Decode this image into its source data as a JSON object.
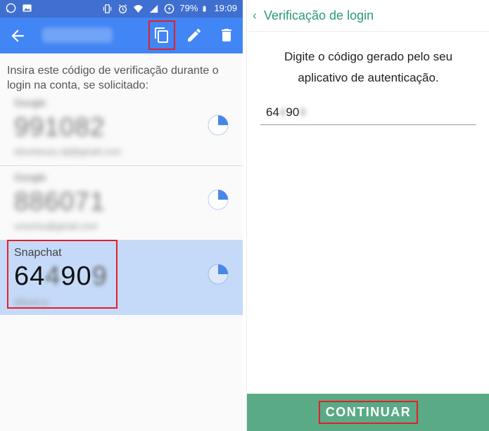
{
  "status_bar": {
    "battery": "79%",
    "time": "19:09"
  },
  "toolbar": {
    "icons": [
      "back-arrow-icon",
      "copy-icon",
      "edit-icon",
      "delete-icon"
    ]
  },
  "authenticator": {
    "instructions": "Insira este código de verificação durante o login na conta, se solicitado:",
    "accounts": [
      {
        "issuer": "Google",
        "code": "991082",
        "user": "elsomeuzu.sjt@gmail.com",
        "timer_fraction": 0.25
      },
      {
        "issuer": "Google",
        "code": "886071",
        "user": "unsomu@gmail.com",
        "timer_fraction": 0.25
      },
      {
        "issuer": "Snapchat",
        "code_visible_1": "64",
        "code_hidden_1": "4",
        "code_visible_2": "90",
        "code_hidden_2": "9",
        "user": "ellsom.p",
        "timer_fraction": 0.25
      }
    ]
  },
  "login_screen": {
    "back_glyph": "‹",
    "title": "Verificação de login",
    "prompt": "Digite o código gerado pelo seu aplicativo de autenticação.",
    "input_visible_1": "64",
    "input_hidden_1": "4",
    "input_visible_2": "90",
    "input_hidden_2": "9",
    "continue_label": "CONTINUAR"
  },
  "colors": {
    "toolbar": "#4285f4",
    "statusbar": "#3f6fd0",
    "selected_row": "#c5daf8",
    "accent_green": "#5aaa85",
    "highlight_red": "#e0202a"
  }
}
